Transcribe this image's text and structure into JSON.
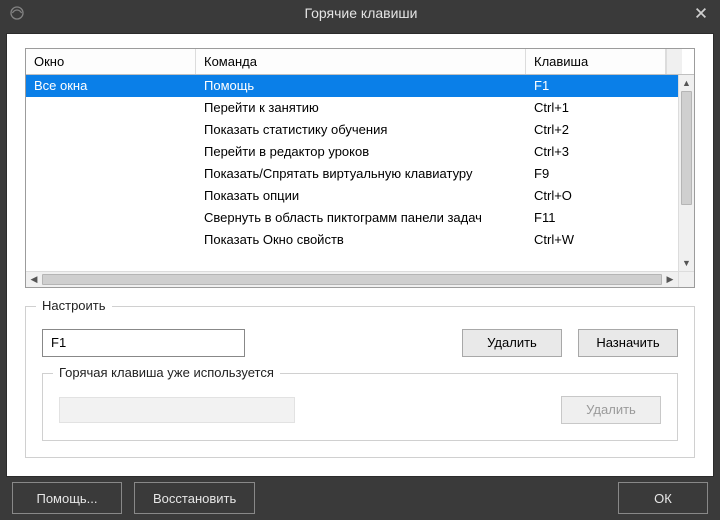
{
  "titlebar": {
    "title": "Горячие клавиши"
  },
  "table": {
    "headers": {
      "window": "Окно",
      "command": "Команда",
      "key": "Клавиша"
    },
    "rows": [
      {
        "window": "Все окна",
        "command": "Помощь",
        "key": "F1",
        "selected": true
      },
      {
        "window": "",
        "command": "Перейти к занятию",
        "key": "Ctrl+1"
      },
      {
        "window": "",
        "command": "Показать статистику обучения",
        "key": "Ctrl+2"
      },
      {
        "window": "",
        "command": "Перейти в редактор уроков",
        "key": "Ctrl+3"
      },
      {
        "window": "",
        "command": "Показать/Спрятать виртуальную клавиатуру",
        "key": "F9"
      },
      {
        "window": "",
        "command": "Показать опции",
        "key": "Ctrl+O"
      },
      {
        "window": "",
        "command": "Свернуть в область пиктограмм панели задач",
        "key": "F11"
      },
      {
        "window": "",
        "command": "Показать Окно свойств",
        "key": "Ctrl+W"
      }
    ]
  },
  "configure": {
    "legend": "Настроить",
    "input_value": "F1",
    "delete_label": "Удалить",
    "assign_label": "Назначить"
  },
  "conflict": {
    "legend": "Горячая клавиша уже используется",
    "delete_label": "Удалить"
  },
  "footer": {
    "help_label": "Помощь...",
    "restore_label": "Восстановить",
    "ok_label": "ОК"
  }
}
